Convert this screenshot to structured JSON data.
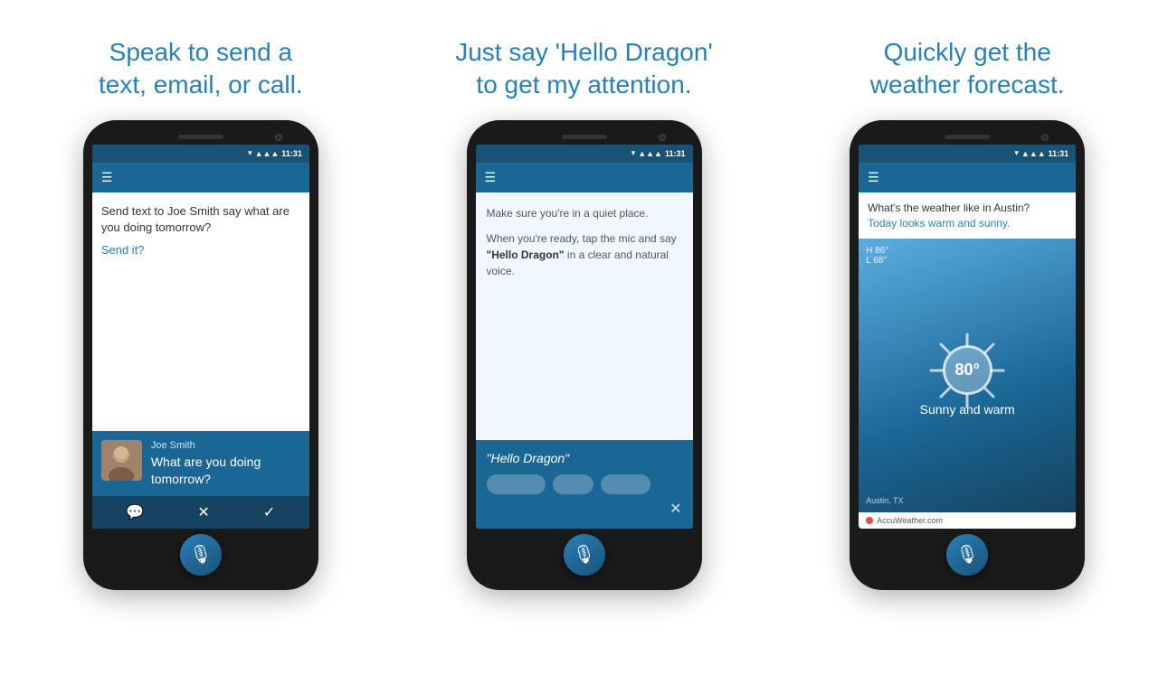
{
  "panel1": {
    "title": "Speak to send a\ntext, email, or call.",
    "phone": {
      "status_time": "11:31",
      "message_text": "Send text to Joe Smith say what are you doing tomorrow?",
      "send_it": "Send it?",
      "contact_name": "Joe Smith",
      "contact_message": "What are you doing tomorrow?",
      "actions": [
        "chat",
        "✕",
        "✓"
      ]
    }
  },
  "panel2": {
    "title": "Just say 'Hello Dragon'\nto get my attention.",
    "phone": {
      "status_time": "11:31",
      "instruction1": "Make sure you're in a quiet place.",
      "instruction2_prefix": "When you're ready, tap the mic and say ",
      "instruction2_bold": "\"Hello Dragon\"",
      "instruction2_suffix": " in a clear and natural voice.",
      "hello_dragon_text": "\"Hello Dragon\""
    }
  },
  "panel3": {
    "title": "Quickly get the\nweather forecast.",
    "phone": {
      "status_time": "11:31",
      "weather_question": "What's the weather like in Austin?",
      "weather_answer": "Today looks warm and sunny.",
      "high": "H 86°",
      "low": "L 68°",
      "temperature": "80°",
      "condition": "Sunny and warm",
      "location": "Austin, TX",
      "accu_weather": "AccuWeather.com"
    }
  }
}
